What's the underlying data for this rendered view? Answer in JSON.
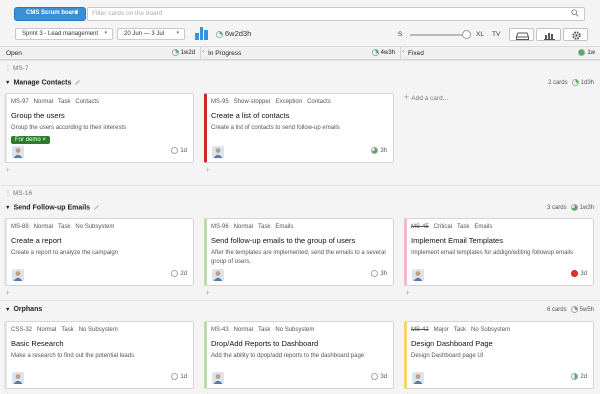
{
  "toolbar": {
    "board_button": "CMS Scrum board",
    "search_placeholder": "Filter cards on the board",
    "sprint_select": "Sprint 3 - Lead management",
    "date_select": "20 Jun — 3 Jul",
    "sprint_total": "6w2d3h",
    "size_labels": [
      "S",
      "XL",
      "TV"
    ],
    "icon_buttons": [
      "inbox-icon",
      "chart-icon",
      "gear-icon"
    ]
  },
  "columns": [
    {
      "name": "Open",
      "duration": "1w2d"
    },
    {
      "name": "In Progress",
      "duration": "4w3h"
    },
    {
      "name": "Fixed",
      "duration": "1w"
    }
  ],
  "add_card_label": "Add a card...",
  "epics": [
    {
      "id": "MS-7",
      "title": "Manage Contacts",
      "cards_count": "2 cards",
      "duration": "1d3h",
      "cards": [
        {
          "col": 0,
          "id": "MS-97",
          "priority": "Normal",
          "type": "Task",
          "component": "Contacts",
          "title": "Group the users",
          "desc": "Group the users according to their interests",
          "tag": "For demo ×",
          "estimate": "1d",
          "accent": "#e3e3e3",
          "progress": 0
        },
        {
          "col": 1,
          "id": "MS-95",
          "priority": "Show-stopper",
          "type": "Exception",
          "component": "Contacts",
          "title": "Create a list of contacts",
          "desc": "Create a list of contacts to send follow-up emails",
          "estimate": "3h",
          "accent": "#c62b2b",
          "progress": 70
        }
      ]
    },
    {
      "id": "MS-16",
      "title": "Send Follow-up Emails",
      "cards_count": "3 cards",
      "duration": "1w3h",
      "cards": [
        {
          "col": 0,
          "id": "MS-88",
          "priority": "Normal",
          "type": "Task",
          "component": "No Subsystem",
          "title": "Create a report",
          "desc": "Create a report to analyze the campaign",
          "estimate": "2d",
          "accent": "#e3e3e3",
          "progress": 0
        },
        {
          "col": 1,
          "id": "MS-96",
          "priority": "Normal",
          "type": "Task",
          "component": "Emails",
          "title": "Send follow-up emails to the group of users",
          "desc": "After the templates are implemented, send the emails to a several group of users.",
          "estimate": "3h",
          "accent": "#b9dca7",
          "progress": 0
        },
        {
          "col": 2,
          "id": "MS-45",
          "priority": "Critical",
          "type": "Task",
          "component": "Emails",
          "title": "Implement Email Templates",
          "desc": "Implement email templates for addign/editing followup emails",
          "estimate": "3d",
          "accent": "#f3b8c9",
          "progress": 100,
          "done": true
        }
      ]
    },
    {
      "id": "",
      "title": "Orphans",
      "cards_count": "6 cards",
      "duration": "5w5h",
      "cards": [
        {
          "col": 0,
          "id": "CSS-32",
          "priority": "Normal",
          "type": "Task",
          "component": "No Subsystem",
          "title": "Basic Research",
          "desc": "Make a research to find out the potential leads",
          "estimate": "1d",
          "accent": "#e3e3e3",
          "progress": 0
        },
        {
          "col": 1,
          "id": "MS-43",
          "priority": "Normal",
          "type": "Task",
          "component": "No Subsystem",
          "title": "Drop/Add Reports to Dashboard",
          "desc": "Add the ability to dpop/add reports to the dashboard page",
          "estimate": "3d",
          "accent": "#b9dca7",
          "progress": 0
        },
        {
          "col": 2,
          "id": "MS-42",
          "priority": "Major",
          "type": "Task",
          "component": "No Subsystem",
          "title": "Design Dashboard Page",
          "desc": "Design Dashboard page UI",
          "estimate": "2d",
          "accent": "#f2d66c",
          "progress": 50,
          "done": true
        }
      ]
    }
  ]
}
